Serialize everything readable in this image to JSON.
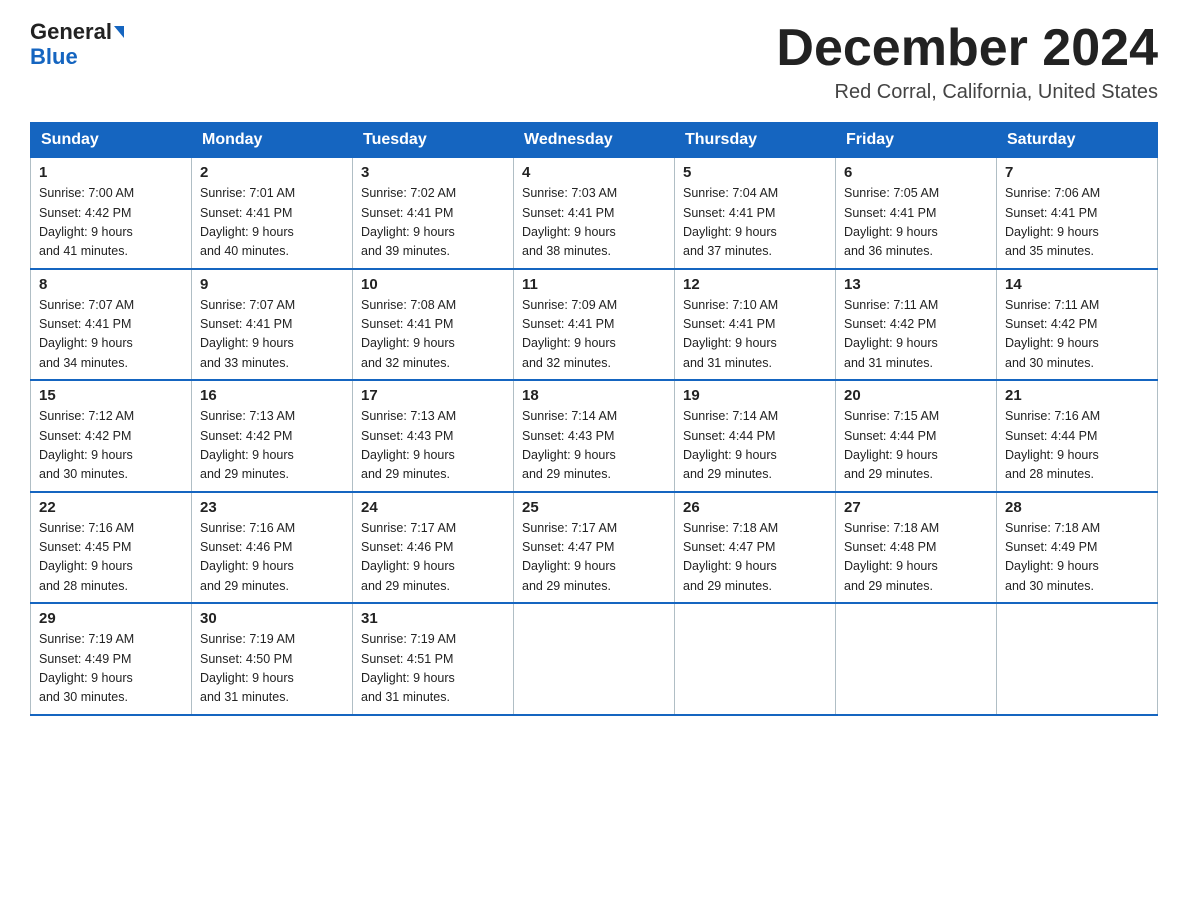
{
  "header": {
    "logo_line1": "General",
    "logo_line2": "Blue",
    "month_title": "December 2024",
    "location": "Red Corral, California, United States"
  },
  "weekdays": [
    "Sunday",
    "Monday",
    "Tuesday",
    "Wednesday",
    "Thursday",
    "Friday",
    "Saturday"
  ],
  "weeks": [
    [
      {
        "day": "1",
        "sunrise": "7:00 AM",
        "sunset": "4:42 PM",
        "daylight": "9 hours and 41 minutes."
      },
      {
        "day": "2",
        "sunrise": "7:01 AM",
        "sunset": "4:41 PM",
        "daylight": "9 hours and 40 minutes."
      },
      {
        "day": "3",
        "sunrise": "7:02 AM",
        "sunset": "4:41 PM",
        "daylight": "9 hours and 39 minutes."
      },
      {
        "day": "4",
        "sunrise": "7:03 AM",
        "sunset": "4:41 PM",
        "daylight": "9 hours and 38 minutes."
      },
      {
        "day": "5",
        "sunrise": "7:04 AM",
        "sunset": "4:41 PM",
        "daylight": "9 hours and 37 minutes."
      },
      {
        "day": "6",
        "sunrise": "7:05 AM",
        "sunset": "4:41 PM",
        "daylight": "9 hours and 36 minutes."
      },
      {
        "day": "7",
        "sunrise": "7:06 AM",
        "sunset": "4:41 PM",
        "daylight": "9 hours and 35 minutes."
      }
    ],
    [
      {
        "day": "8",
        "sunrise": "7:07 AM",
        "sunset": "4:41 PM",
        "daylight": "9 hours and 34 minutes."
      },
      {
        "day": "9",
        "sunrise": "7:07 AM",
        "sunset": "4:41 PM",
        "daylight": "9 hours and 33 minutes."
      },
      {
        "day": "10",
        "sunrise": "7:08 AM",
        "sunset": "4:41 PM",
        "daylight": "9 hours and 32 minutes."
      },
      {
        "day": "11",
        "sunrise": "7:09 AM",
        "sunset": "4:41 PM",
        "daylight": "9 hours and 32 minutes."
      },
      {
        "day": "12",
        "sunrise": "7:10 AM",
        "sunset": "4:41 PM",
        "daylight": "9 hours and 31 minutes."
      },
      {
        "day": "13",
        "sunrise": "7:11 AM",
        "sunset": "4:42 PM",
        "daylight": "9 hours and 31 minutes."
      },
      {
        "day": "14",
        "sunrise": "7:11 AM",
        "sunset": "4:42 PM",
        "daylight": "9 hours and 30 minutes."
      }
    ],
    [
      {
        "day": "15",
        "sunrise": "7:12 AM",
        "sunset": "4:42 PM",
        "daylight": "9 hours and 30 minutes."
      },
      {
        "day": "16",
        "sunrise": "7:13 AM",
        "sunset": "4:42 PM",
        "daylight": "9 hours and 29 minutes."
      },
      {
        "day": "17",
        "sunrise": "7:13 AM",
        "sunset": "4:43 PM",
        "daylight": "9 hours and 29 minutes."
      },
      {
        "day": "18",
        "sunrise": "7:14 AM",
        "sunset": "4:43 PM",
        "daylight": "9 hours and 29 minutes."
      },
      {
        "day": "19",
        "sunrise": "7:14 AM",
        "sunset": "4:44 PM",
        "daylight": "9 hours and 29 minutes."
      },
      {
        "day": "20",
        "sunrise": "7:15 AM",
        "sunset": "4:44 PM",
        "daylight": "9 hours and 29 minutes."
      },
      {
        "day": "21",
        "sunrise": "7:16 AM",
        "sunset": "4:44 PM",
        "daylight": "9 hours and 28 minutes."
      }
    ],
    [
      {
        "day": "22",
        "sunrise": "7:16 AM",
        "sunset": "4:45 PM",
        "daylight": "9 hours and 28 minutes."
      },
      {
        "day": "23",
        "sunrise": "7:16 AM",
        "sunset": "4:46 PM",
        "daylight": "9 hours and 29 minutes."
      },
      {
        "day": "24",
        "sunrise": "7:17 AM",
        "sunset": "4:46 PM",
        "daylight": "9 hours and 29 minutes."
      },
      {
        "day": "25",
        "sunrise": "7:17 AM",
        "sunset": "4:47 PM",
        "daylight": "9 hours and 29 minutes."
      },
      {
        "day": "26",
        "sunrise": "7:18 AM",
        "sunset": "4:47 PM",
        "daylight": "9 hours and 29 minutes."
      },
      {
        "day": "27",
        "sunrise": "7:18 AM",
        "sunset": "4:48 PM",
        "daylight": "9 hours and 29 minutes."
      },
      {
        "day": "28",
        "sunrise": "7:18 AM",
        "sunset": "4:49 PM",
        "daylight": "9 hours and 30 minutes."
      }
    ],
    [
      {
        "day": "29",
        "sunrise": "7:19 AM",
        "sunset": "4:49 PM",
        "daylight": "9 hours and 30 minutes."
      },
      {
        "day": "30",
        "sunrise": "7:19 AM",
        "sunset": "4:50 PM",
        "daylight": "9 hours and 31 minutes."
      },
      {
        "day": "31",
        "sunrise": "7:19 AM",
        "sunset": "4:51 PM",
        "daylight": "9 hours and 31 minutes."
      },
      null,
      null,
      null,
      null
    ]
  ],
  "labels": {
    "sunrise_prefix": "Sunrise: ",
    "sunset_prefix": "Sunset: ",
    "daylight_prefix": "Daylight: "
  }
}
